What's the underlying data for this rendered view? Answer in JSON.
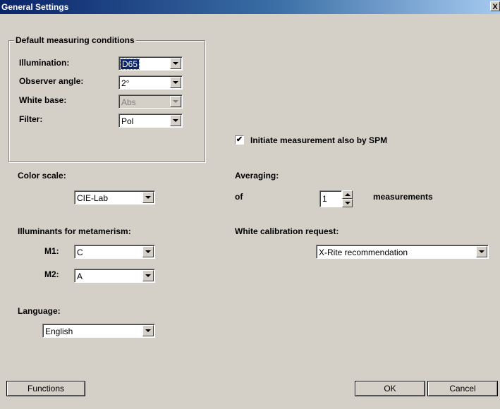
{
  "window": {
    "title": "General Settings",
    "close_label": "X"
  },
  "measuring": {
    "group_title": "Default measuring conditions",
    "illumination": {
      "label": "Illumination:",
      "value": "D65"
    },
    "observer": {
      "label": "Observer angle:",
      "value": "2°"
    },
    "white_base": {
      "label": "White base:",
      "value": "Abs"
    },
    "filter": {
      "label": "Filter:",
      "value": "Pol"
    }
  },
  "spm": {
    "label": "Initiate measurement also by SPM",
    "checked": "✔"
  },
  "color_scale": {
    "label": "Color scale:",
    "value": "CIE-Lab"
  },
  "averaging": {
    "label": "Averaging:",
    "prefix": "of",
    "value": "1",
    "suffix": "measurements"
  },
  "metamerism": {
    "label": "Illuminants for metamerism:",
    "m1": {
      "label": "M1:",
      "value": "C"
    },
    "m2": {
      "label": "M2:",
      "value": "A"
    }
  },
  "white_calibration": {
    "label": "White calibration request:",
    "value": "X-Rite recommendation"
  },
  "language": {
    "label": "Language:",
    "value": "English"
  },
  "buttons": {
    "functions": "Functions",
    "ok": "OK",
    "cancel": "Cancel"
  }
}
